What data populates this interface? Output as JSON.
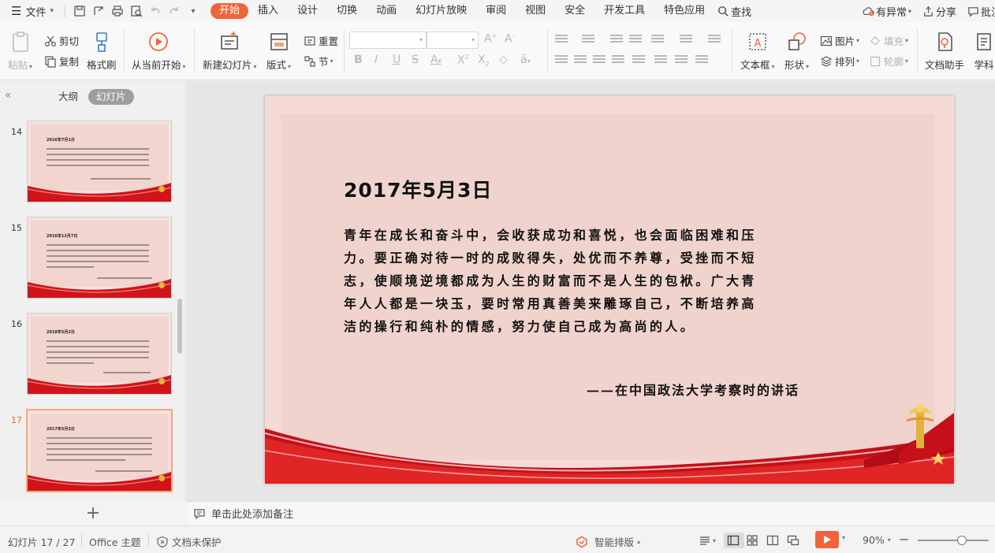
{
  "menubar": {
    "file_label": "文件",
    "tabs": [
      {
        "label": "开始",
        "active": true
      },
      {
        "label": "插入"
      },
      {
        "label": "设计"
      },
      {
        "label": "切换"
      },
      {
        "label": "动画"
      },
      {
        "label": "幻灯片放映"
      },
      {
        "label": "审阅"
      },
      {
        "label": "视图"
      },
      {
        "label": "安全"
      },
      {
        "label": "开发工具"
      },
      {
        "label": "特色应用"
      }
    ],
    "search_label": "查找",
    "right": {
      "anomaly_label": "有异常",
      "share_label": "分享",
      "comment_label": "批注"
    }
  },
  "ribbon": {
    "paste_label": "粘贴",
    "cut_label": "剪切",
    "copy_label": "复制",
    "format_painter_label": "格式刷",
    "play_from_current_label": "从当前开始",
    "new_slide_label": "新建幻灯片",
    "layout_label": "版式",
    "reset_label": "重置",
    "section_label": "节",
    "textbox_label": "文本框",
    "shape_label": "形状",
    "picture_label": "图片",
    "arrange_label": "排列",
    "fill_label": "填充",
    "outline_label": "轮廓",
    "doc_assistant_label": "文档助手",
    "academic_label": "学科"
  },
  "leftpanel": {
    "collapse_icon": "double-chevron-left-icon",
    "tab_outline": "大纲",
    "tab_slides": "幻灯片",
    "thumbnails": [
      {
        "number": "14",
        "date": "2016年7月1日"
      },
      {
        "number": "15",
        "date": "2016年12月7日"
      },
      {
        "number": "16",
        "date": "2018年5月2日"
      },
      {
        "number": "17",
        "date": "2017年5月3日",
        "current": true
      }
    ],
    "add_label": "+"
  },
  "slide": {
    "title": "2017年5月3日",
    "body_lines": [
      "青年在成长和奋斗中，会收获成功和喜悦，也会面临困难和压",
      "力。要正确对待一时的成败得失，处优而不养尊，受挫而不短",
      "志，使顺境逆境都成为人生的财富而不是人生的包袱。广大青",
      "年人人都是一块玉，要时常用真善美来雕琢自己，不断培养高",
      "洁的操行和纯朴的情感，努力使自己成为高尚的人。"
    ],
    "signature": "——在中国政法大学考察时的讲话"
  },
  "notes": {
    "placeholder": "单击此处添加备注"
  },
  "statusbar": {
    "slide_counter": "幻灯片 17 / 27",
    "theme": "Office 主题",
    "protection": "文档未保护",
    "smart_layout": "智能排版",
    "zoom": "90%",
    "zoom_level": 0.62
  },
  "colors": {
    "accent": "#f0643c",
    "slide_bg": "#f1d3cd",
    "wave_red": "#d0141a"
  }
}
